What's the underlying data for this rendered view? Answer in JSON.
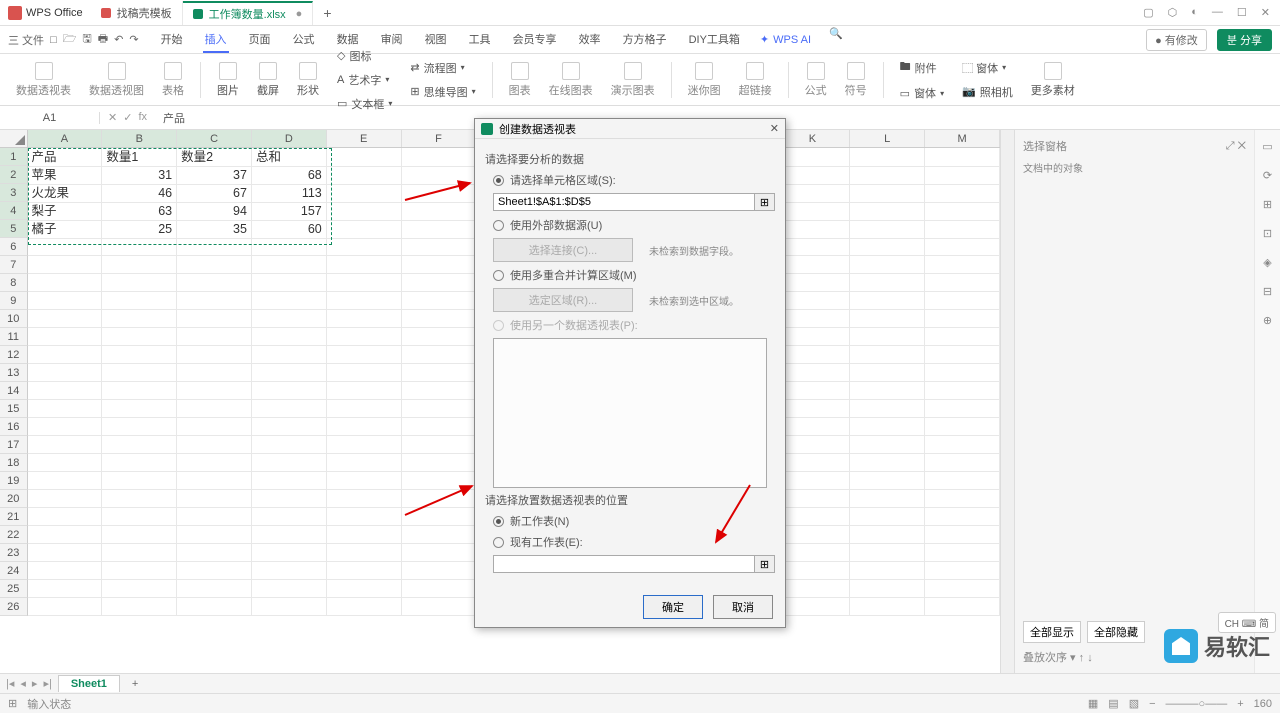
{
  "app": {
    "name": "WPS Office"
  },
  "tabs": [
    {
      "label": "找稿壳模板",
      "icon": "red"
    },
    {
      "label": "工作簿数量.xlsx",
      "icon": "green",
      "active": true
    }
  ],
  "menu": {
    "file": "三 文件",
    "items": [
      "开始",
      "插入",
      "页面",
      "公式",
      "数据",
      "审阅",
      "视图",
      "工具",
      "会员专享",
      "效率",
      "方方格子",
      "DIY工具箱"
    ],
    "activeIdx": 1,
    "wpsai": "WPS AI",
    "pending": "● 有修改",
    "share": "분 分享"
  },
  "ribbon": {
    "g1": [
      "数据透视表",
      "数据透视图",
      "表格"
    ],
    "g2": [
      "图片",
      "截屏",
      "形状"
    ],
    "g3": [
      "图标",
      "艺术字",
      "文本框"
    ],
    "g4": {
      "flow": "流程图",
      "mind": "思维导图"
    },
    "g5": [
      "图表",
      "在线图表",
      "演示图表"
    ],
    "g6": [
      "迷你图",
      "超链接"
    ],
    "g7": [
      "公式",
      "符号"
    ],
    "g8": [
      "附件",
      "窗体",
      "照相机"
    ],
    "more": "更多素材"
  },
  "formula": {
    "nameBox": "A1",
    "value": "产品"
  },
  "cols": [
    "A",
    "B",
    "C",
    "D",
    "E",
    "F",
    "G",
    "H",
    "I",
    "J",
    "K",
    "L",
    "M"
  ],
  "data": {
    "headers": [
      "产品",
      "数量1",
      "数量2",
      "总和"
    ],
    "rows": [
      [
        "苹果",
        "31",
        "37",
        "68"
      ],
      [
        "火龙果",
        "46",
        "67",
        "113"
      ],
      [
        "梨子",
        "63",
        "94",
        "157"
      ],
      [
        "橘子",
        "25",
        "35",
        "60"
      ]
    ]
  },
  "dialog": {
    "title": "创建数据透视表",
    "sec1": "请选择要分析的数据",
    "opt1": "请选择单元格区域(S):",
    "range": "Sheet1!$A$1:$D$5",
    "opt2": "使用外部数据源(U)",
    "btn2": "选择连接(C)...",
    "hint2": "未检索到数据字段。",
    "opt3": "使用多重合并计算区域(M)",
    "btn3": "选定区域(R)...",
    "hint3": "未检索到选中区域。",
    "opt4": "使用另一个数据透视表(P):",
    "sec2": "请选择放置数据透视表的位置",
    "loc1": "新工作表(N)",
    "loc2": "现有工作表(E):",
    "ok": "确定",
    "cancel": "取消"
  },
  "side": {
    "title": "选择窗格",
    "sub": "文档中的对象",
    "order": "叠放次序",
    "all": "全部显示",
    "hide": "全部隐藏"
  },
  "sheet": {
    "name": "Sheet1"
  },
  "status": {
    "label": "输入状态",
    "zoom": "160",
    "lang": "CH ⌨ 简"
  },
  "watermark": "易软汇"
}
